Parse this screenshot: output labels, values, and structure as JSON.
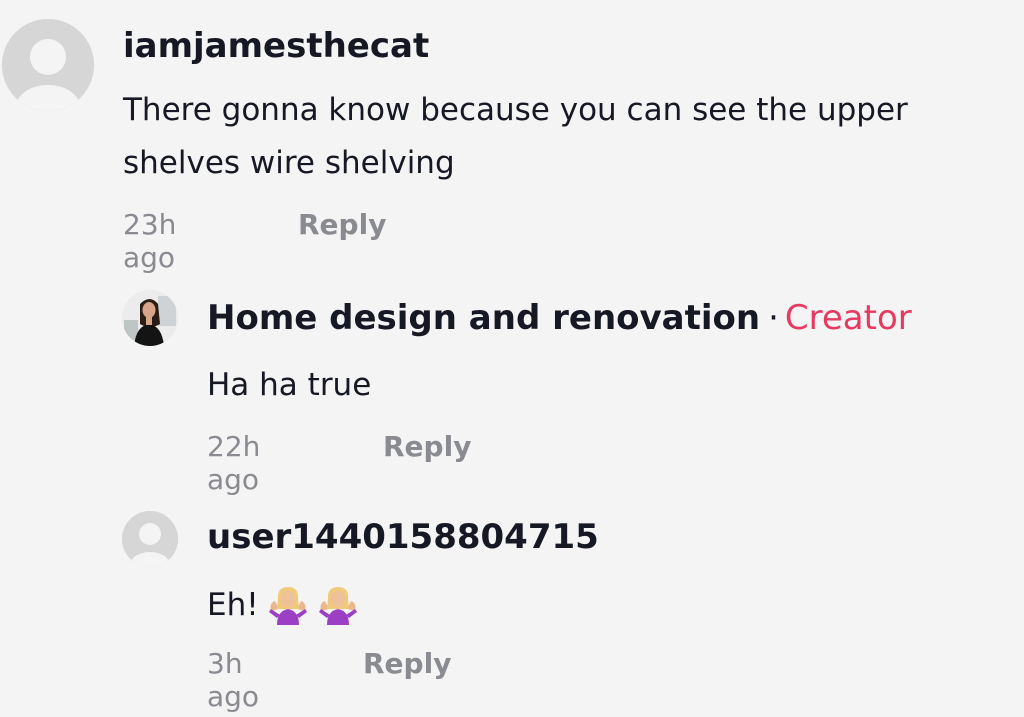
{
  "comments": [
    {
      "username": "iamjamesthecat",
      "text_line1": "There gonna know because you can see the upper",
      "text_line2": "shelves wire shelving",
      "time": "23h ago",
      "reply_label": "Reply",
      "avatar": "default-avatar-icon"
    },
    {
      "username": "Home design and renovation",
      "separator": "·",
      "badge": "Creator",
      "text": "Ha ha true",
      "time": "22h ago",
      "reply_label": "Reply",
      "avatar": "creator-photo"
    },
    {
      "username": "user1440158804715",
      "text": "Eh!",
      "emojis": [
        "person-shrugging-emoji",
        "person-shrugging-emoji"
      ],
      "time": "3h ago",
      "reply_label": "Reply",
      "avatar": "default-avatar-icon"
    }
  ],
  "colors": {
    "background": "#f4f4f4",
    "text": "#161823",
    "secondary": "#8a8b91",
    "creator": "#e63a62",
    "avatar_bg": "#d9d9d9"
  }
}
